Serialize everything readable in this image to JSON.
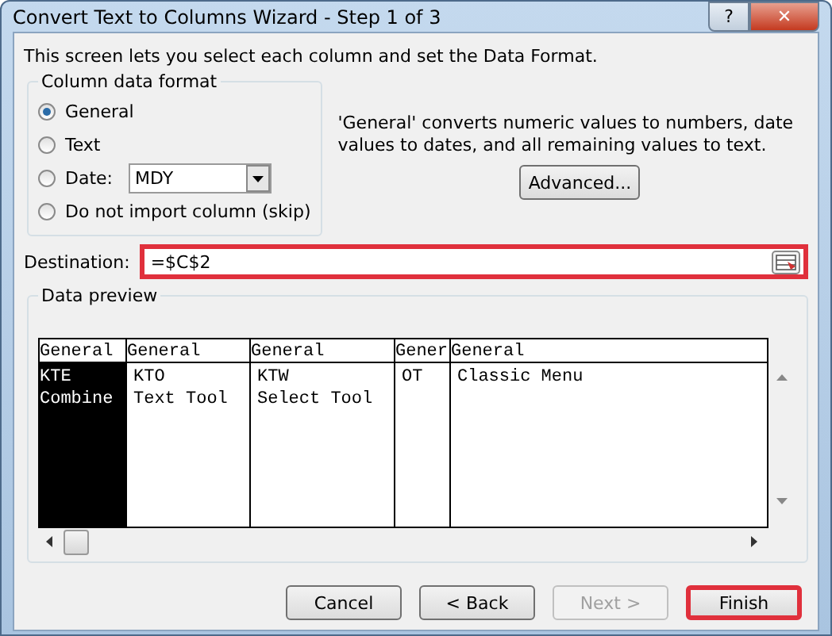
{
  "window": {
    "title": "Convert Text to Columns Wizard - Step 1 of 3",
    "help_button": "?",
    "close_button": "✕"
  },
  "intro": "This screen lets you select each column and set the Data Format.",
  "format_group": {
    "title": "Column data format",
    "options": [
      {
        "label": "General",
        "selected": true,
        "kind": "plain"
      },
      {
        "label": "Text",
        "selected": false,
        "kind": "plain"
      },
      {
        "label": "Date:",
        "selected": false,
        "kind": "date",
        "dropdown": "MDY"
      },
      {
        "label": "Do not import column (skip)",
        "selected": false,
        "kind": "plain"
      }
    ]
  },
  "description": "'General' converts numeric values to numbers, date values to dates, and all remaining values to text.",
  "advanced_button": "Advanced...",
  "destination": {
    "label": "Destination:",
    "value": "=$C$2",
    "highlighted": true
  },
  "preview": {
    "title": "Data preview",
    "columns": [
      {
        "header": "General",
        "selected": true,
        "cells": [
          "KTE",
          "Combine"
        ]
      },
      {
        "header": "General",
        "selected": false,
        "cells": [
          "KTO",
          "Text Tool"
        ]
      },
      {
        "header": "General",
        "selected": false,
        "cells": [
          "KTW",
          "Select Tool"
        ]
      },
      {
        "header": "Gener",
        "selected": false,
        "cells": [
          "OT",
          ""
        ]
      },
      {
        "header": "General",
        "selected": false,
        "cells": [
          "Classic Menu",
          ""
        ]
      }
    ]
  },
  "buttons": [
    {
      "label": "Cancel",
      "disabled": false,
      "highlighted": false
    },
    {
      "label": "< Back",
      "disabled": false,
      "highlighted": false
    },
    {
      "label": "Next >",
      "disabled": true,
      "highlighted": false
    },
    {
      "label": "Finish",
      "disabled": false,
      "highlighted": true
    }
  ]
}
